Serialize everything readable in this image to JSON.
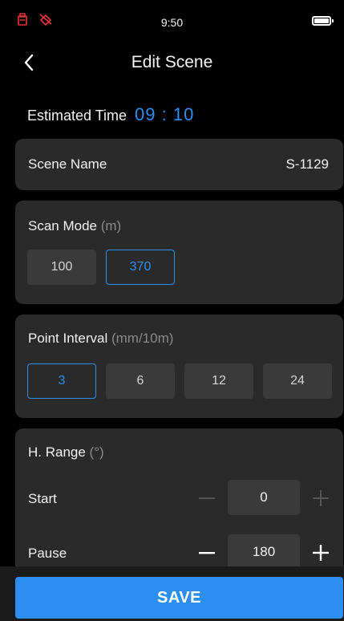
{
  "status": {
    "time": "9:50"
  },
  "header": {
    "title": "Edit Scene"
  },
  "estimated": {
    "label": "Estimated Time",
    "value": "09 : 10"
  },
  "scene_name": {
    "label": "Scene Name",
    "value": "S-1129"
  },
  "scan_mode": {
    "label": "Scan Mode",
    "unit": " (m)",
    "options": [
      "100",
      "370"
    ],
    "selected": "370"
  },
  "point_interval": {
    "label": "Point Interval",
    "unit": " (mm/10m)",
    "options": [
      "3",
      "6",
      "12",
      "24"
    ],
    "selected": "3"
  },
  "h_range": {
    "label": "H. Range",
    "unit": " (°)",
    "start": {
      "label": "Start",
      "value": "0"
    },
    "pause": {
      "label": "Pause",
      "value": "180"
    }
  },
  "save": {
    "label": "SAVE"
  },
  "colors": {
    "accent": "#2e8ef0",
    "card": "#2a2a2a",
    "chip": "#3a3a3a",
    "status_icon": "#e8343c"
  }
}
